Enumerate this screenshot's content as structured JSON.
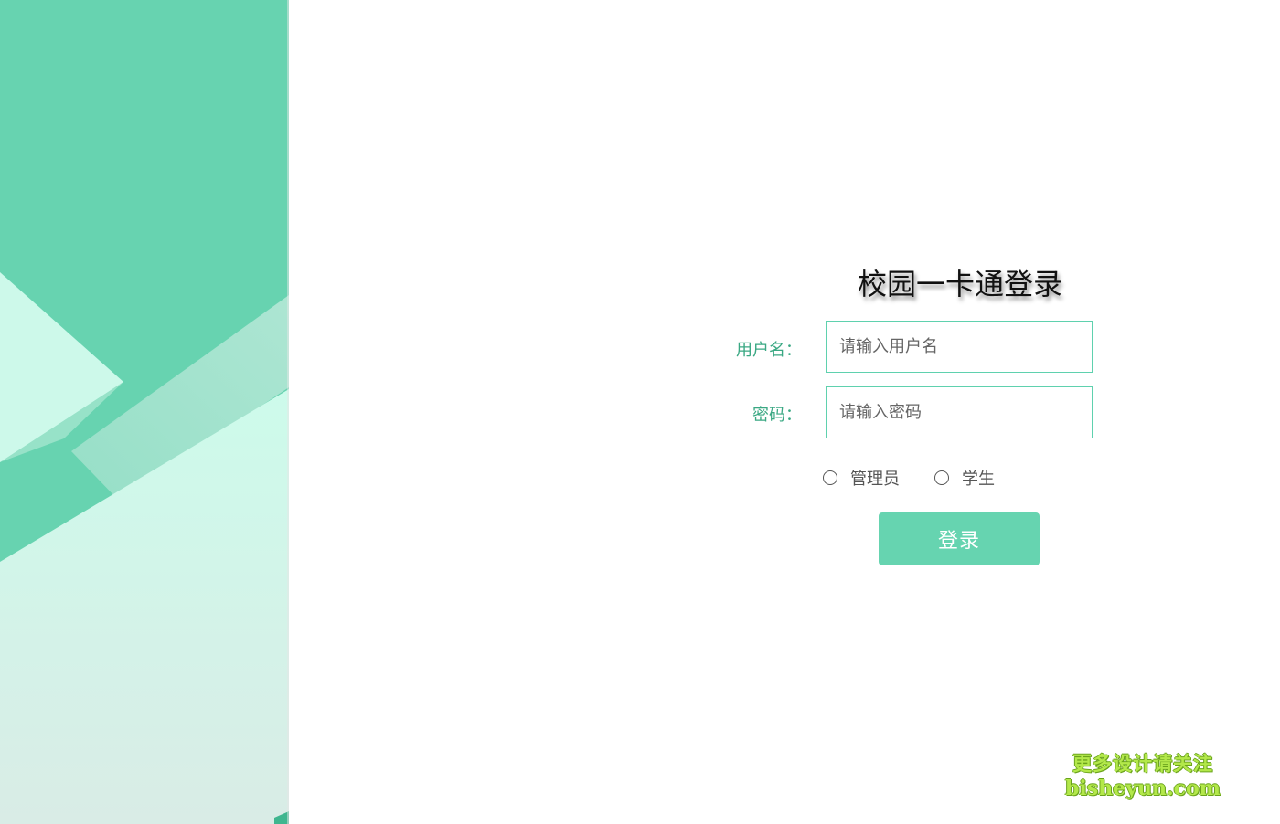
{
  "login": {
    "title": "校园一卡通登录",
    "username_label": "用户名：",
    "username_placeholder": "请输入用户名",
    "password_label": "密码：",
    "password_placeholder": "请输入密码",
    "roles": [
      {
        "label": "管理员",
        "selected": false
      },
      {
        "label": "学生",
        "selected": false
      }
    ],
    "submit_label": "登录"
  },
  "watermark": {
    "line1": "更多设计请关注",
    "line2": "bisheyun.com"
  },
  "colors": {
    "accent": "#66d4b0",
    "label": "#3aa883",
    "input_border": "#5fd1ae",
    "panel_dark": "#67d3b0",
    "panel_light": "#cdf9ea",
    "watermark": "#b3e84a"
  }
}
